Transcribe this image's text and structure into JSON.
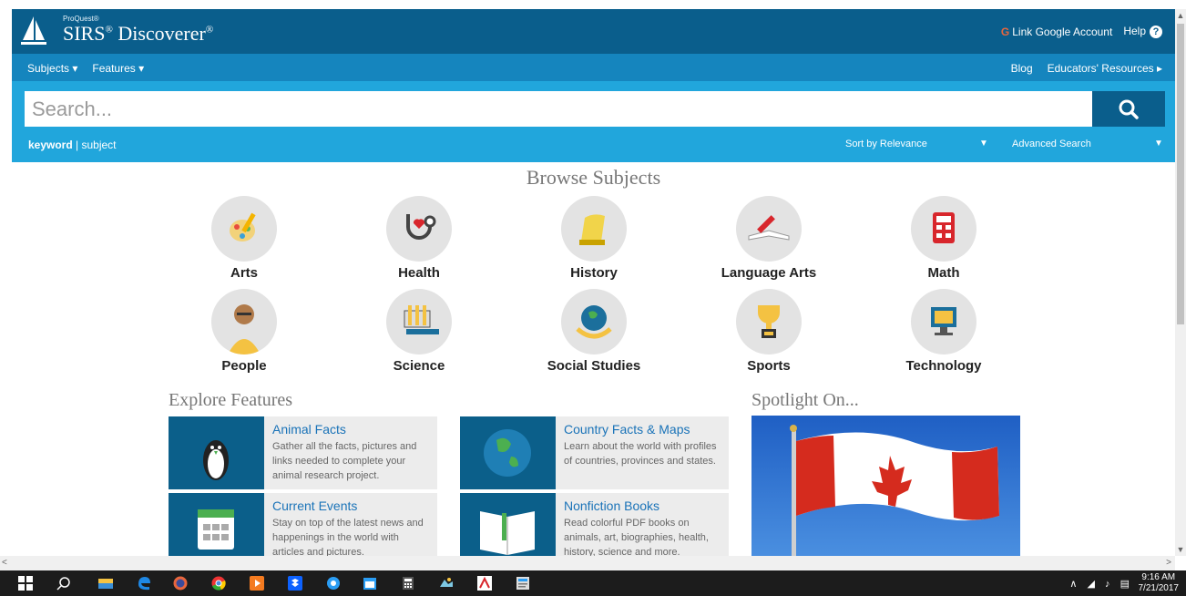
{
  "header": {
    "proquest": "ProQuest®",
    "brand": "SIRS",
    "brand_suffix": "Discoverer",
    "reg": "®",
    "google_link": "Link Google Account",
    "help": "Help",
    "help_glyph": "?"
  },
  "nav": {
    "subjects": "Subjects ▾",
    "features": "Features ▾",
    "blog": "Blog",
    "educators": "Educators' Resources ▸"
  },
  "search": {
    "placeholder": "Search...",
    "keyword": "keyword",
    "separator": " | ",
    "subject": "subject",
    "sort": "Sort by Relevance",
    "advanced": "Advanced Search"
  },
  "browse": {
    "title": "Browse Subjects",
    "subjects": [
      {
        "label": "Arts",
        "icon": "palette-icon"
      },
      {
        "label": "Health",
        "icon": "stethoscope-icon"
      },
      {
        "label": "History",
        "icon": "scroll-icon"
      },
      {
        "label": "Language Arts",
        "icon": "book-pen-icon"
      },
      {
        "label": "Math",
        "icon": "calculator-icon"
      },
      {
        "label": "People",
        "icon": "person-icon"
      },
      {
        "label": "Science",
        "icon": "lab-icon"
      },
      {
        "label": "Social Studies",
        "icon": "globe-hands-icon"
      },
      {
        "label": "Sports",
        "icon": "trophy-icon"
      },
      {
        "label": "Technology",
        "icon": "computer-icon"
      }
    ]
  },
  "explore": {
    "title": "Explore Features",
    "features": [
      {
        "title": "Animal Facts",
        "desc": "Gather all the facts, pictures and links needed to complete your animal research project."
      },
      {
        "title": "Country Facts & Maps",
        "desc": "Learn about the world with profiles of countries, provinces and states."
      },
      {
        "title": "Current Events",
        "desc": "Stay on top of the latest news and happenings in the world with articles and pictures."
      },
      {
        "title": "Nonfiction Books",
        "desc": "Read colorful PDF books on animals, art, biographies, health, history, science and more."
      }
    ]
  },
  "spotlight": {
    "title": "Spotlight On..."
  },
  "taskbar": {
    "time": "9:16 AM",
    "date": "7/21/2017"
  },
  "colors": {
    "header": "#0a5e8c",
    "nav": "#1585be",
    "search_bar": "#21a6dc",
    "feature_tile": "#0b5f8a"
  }
}
